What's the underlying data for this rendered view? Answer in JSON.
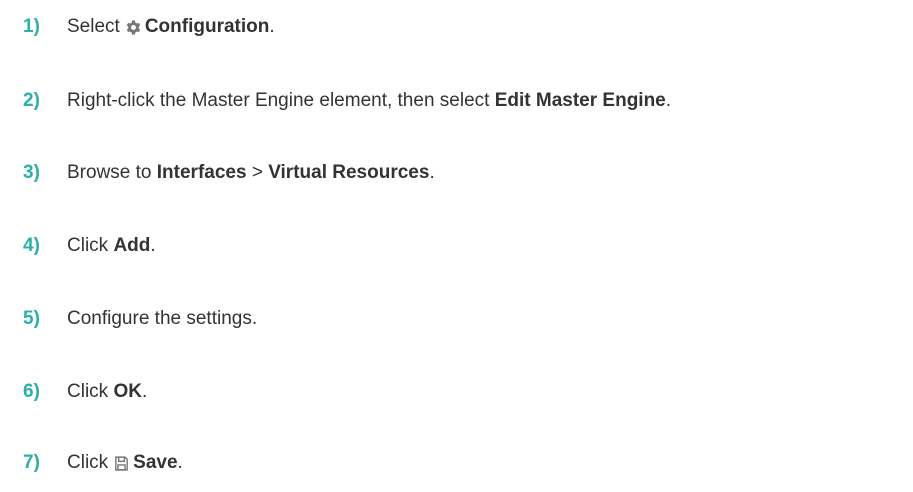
{
  "steps": [
    {
      "number": "1)",
      "before": "Select",
      "icon": "gear-icon",
      "bold": "Configuration",
      "after": "."
    },
    {
      "number": "2)",
      "before": "Right-click the Master Engine element, then select ",
      "bold": "Edit Master Engine",
      "after": "."
    },
    {
      "number": "3)",
      "before": "Browse to ",
      "bold_1": "Interfaces",
      "separator": " > ",
      "bold_2": "Virtual Resources",
      "after": "."
    },
    {
      "number": "4)",
      "before": "Click ",
      "bold": "Add",
      "after": "."
    },
    {
      "number": "5)",
      "text": "Configure the settings."
    },
    {
      "number": "6)",
      "before": "Click ",
      "bold": "OK",
      "after": "."
    },
    {
      "number": "7)",
      "before": "Click",
      "icon": "save-icon",
      "bold": "Save",
      "after": "."
    }
  ],
  "colors": {
    "step_number": "#2bb0a4",
    "text": "#333333",
    "icon": "#777777"
  }
}
